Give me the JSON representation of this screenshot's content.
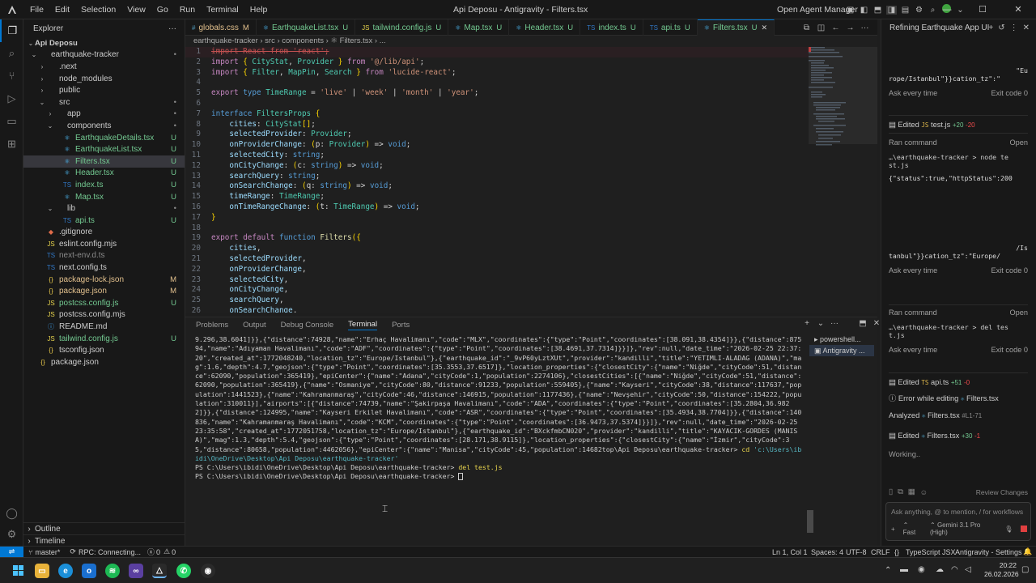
{
  "menu": [
    "File",
    "Edit",
    "Selection",
    "View",
    "Go",
    "Run",
    "Terminal",
    "Help"
  ],
  "window_title": "Api Deposu - Antigravity - Filters.tsx",
  "open_agent_manager": "Open Agent Manager",
  "sidebar": {
    "title": "Explorer",
    "root": "Api Deposu",
    "items": [
      {
        "label": "earthquake-tracker",
        "indent": 0,
        "arrow": "⌄",
        "status": "•"
      },
      {
        "label": ".next",
        "indent": 1,
        "arrow": "›",
        "status": ""
      },
      {
        "label": "node_modules",
        "indent": 1,
        "arrow": "›",
        "status": ""
      },
      {
        "label": "public",
        "indent": 1,
        "arrow": "›",
        "status": ""
      },
      {
        "label": "src",
        "indent": 1,
        "arrow": "⌄",
        "status": "•"
      },
      {
        "label": "app",
        "indent": 2,
        "arrow": "›",
        "status": "•"
      },
      {
        "label": "components",
        "indent": 2,
        "arrow": "⌄",
        "status": "•"
      },
      {
        "label": "EarthquakeDetails.tsx",
        "indent": 3,
        "arrow": "",
        "status": "U"
      },
      {
        "label": "EarthquakeList.tsx",
        "indent": 3,
        "arrow": "",
        "status": "U"
      },
      {
        "label": "Filters.tsx",
        "indent": 3,
        "arrow": "",
        "status": "U"
      },
      {
        "label": "Header.tsx",
        "indent": 3,
        "arrow": "",
        "status": "U"
      },
      {
        "label": "index.ts",
        "indent": 3,
        "arrow": "",
        "status": "U"
      },
      {
        "label": "Map.tsx",
        "indent": 3,
        "arrow": "",
        "status": "U"
      },
      {
        "label": "lib",
        "indent": 2,
        "arrow": "⌄",
        "status": "•"
      },
      {
        "label": "api.ts",
        "indent": 3,
        "arrow": "",
        "status": "U"
      },
      {
        "label": ".gitignore",
        "indent": 1,
        "arrow": "",
        "status": ""
      },
      {
        "label": "eslint.config.mjs",
        "indent": 1,
        "arrow": "",
        "status": ""
      },
      {
        "label": "next-env.d.ts",
        "indent": 1,
        "arrow": "",
        "status": ""
      },
      {
        "label": "next.config.ts",
        "indent": 1,
        "arrow": "",
        "status": ""
      },
      {
        "label": "package-lock.json",
        "indent": 1,
        "arrow": "",
        "status": "M"
      },
      {
        "label": "package.json",
        "indent": 1,
        "arrow": "",
        "status": "M"
      },
      {
        "label": "postcss.config.js",
        "indent": 1,
        "arrow": "",
        "status": "U"
      },
      {
        "label": "postcss.config.mjs",
        "indent": 1,
        "arrow": "",
        "status": ""
      },
      {
        "label": "README.md",
        "indent": 1,
        "arrow": "",
        "status": ""
      },
      {
        "label": "tailwind.config.js",
        "indent": 1,
        "arrow": "",
        "status": "U"
      },
      {
        "label": "tsconfig.json",
        "indent": 1,
        "arrow": "",
        "status": ""
      },
      {
        "label": "package.json",
        "indent": 0,
        "arrow": "",
        "status": ""
      }
    ],
    "outline": "Outline",
    "timeline": "Timeline"
  },
  "tabs": [
    {
      "label": "globals.css",
      "status": "M"
    },
    {
      "label": "EarthquakeList.tsx",
      "status": "U"
    },
    {
      "label": "tailwind.config.js",
      "status": "U"
    },
    {
      "label": "Map.tsx",
      "status": "U"
    },
    {
      "label": "Header.tsx",
      "status": "U"
    },
    {
      "label": "index.ts",
      "status": "U"
    },
    {
      "label": "api.ts",
      "status": "U"
    },
    {
      "label": "Filters.tsx",
      "status": "U"
    }
  ],
  "breadcrumb": "earthquake-tracker  ›  src  ›  components  ›  ⚛ Filters.tsx  ›  ...",
  "code_lines": [
    "import React from 'react';",
    "import { CityStat, Provider } from '@/lib/api';",
    "import { Filter, MapPin, Search } from 'lucide-react';",
    "",
    "export type TimeRange = 'live' | 'week' | 'month' | 'year';",
    "",
    "interface FiltersProps {",
    "    cities: CityStat[];",
    "    selectedProvider: Provider;",
    "    onProviderChange: (p: Provider) => void;",
    "    selectedCity: string;",
    "    onCityChange: (c: string) => void;",
    "    searchQuery: string;",
    "    onSearchChange: (q: string) => void;",
    "    timeRange: TimeRange;",
    "    onTimeRangeChange: (t: TimeRange) => void;",
    "}",
    "",
    "export default function Filters({",
    "    cities,",
    "    selectedProvider,",
    "    onProviderChange,",
    "    selectedCity,",
    "    onCityChange,",
    "    searchQuery,",
    "    onSearchChange,"
  ],
  "panel_tabs": [
    "Problems",
    "Output",
    "Debug Console",
    "Terminal",
    "Ports"
  ],
  "terminal": {
    "output": "9.296,38.6041]}},{\"distance\":74928,\"name\":\"Erhaç Havalimanı\",\"code\":\"MLX\",\"coordinates\":{\"type\":\"Point\",\"coordinates\":[38.091,38.4354]}},{\"distance\":87594,\"name\":\"Adıyaman Havalimanı\",\"code\":\"ADF\",\"coordinates\":{\"type\":\"Point\",\"coordinates\":[38.4691,37.7314]}}]},\"rev\":null,\"date_time\":\"2026-02-25 22:37:20\",\"created_at\":1772048240,\"location_tz\":\"Europe/Istanbul\"},{\"earthquake_id\":\"_9vP60yLztXUt\",\"provider\":\"kandilli\",\"title\":\"YETIMLI-ALADAG (ADANA)\",\"mag\":1.6,\"depth\":4.7,\"geojson\":{\"type\":\"Point\",\"coordinates\":[35.3553,37.6517]},\"location_properties\":{\"closestCity\":{\"name\":\"Niğde\",\"cityCode\":51,\"distance\":62090,\"population\":365419},\"epiCenter\":{\"name\":\"Adana\",\"cityCode\":1,\"population\":2274106},\"closestCities\":[{\"name\":\"Niğde\",\"cityCode\":51,\"distance\":62090,\"population\":365419},{\"name\":\"Osmaniye\",\"cityCode\":80,\"distance\":91233,\"population\":559405},{\"name\":\"Kayseri\",\"cityCode\":38,\"distance\":117637,\"population\":1441523},{\"name\":\"Kahramanmaraş\",\"cityCode\":46,\"distance\":146915,\"population\":1177436},{\"name\":\"Nevşehir\",\"cityCode\":50,\"distance\":154222,\"population\":310011}],\"airports\":[{\"distance\":74739,\"name\":\"Şakirpaşa Havalimanı\",\"code\":\"ADA\",\"coordinates\":{\"type\":\"Point\",\"coordinates\":[35.2804,36.9822]}},{\"distance\":124995,\"name\":\"Kayseri Erkilet Havalimanı\",\"code\":\"ASR\",\"coordinates\":{\"type\":\"Point\",\"coordinates\":[35.4934,38.7704]}},{\"distance\":140836,\"name\":\"Kahramanmaraş Havalimanı\",\"code\":\"KCM\",\"coordinates\":{\"type\":\"Point\",\"coordinates\":[36.9473,37.5374]}}]},\"rev\":null,\"date_time\":\"2026-02-25 23:35:58\",\"created_at\":1772051758,\"location_tz\":\"Europe/Istanbul\"},{\"earthquake_id\":\"BXckfmbCN020\",\"provider\":\"kandilli\",\"title\":\"KAYACIK-GORDES (MANISA)\",\"mag\":1.3,\"depth\":5.4,\"geojson\":{\"type\":\"Point\",\"coordinates\":[28.171,38.9115]},\"location_properties\":{\"closestCity\":{\"name\":\"İzmir\",\"cityCode\":35,\"distance\":80658,\"population\":4462056},\"epiCenter\":{\"name\":\"Manisa\",\"cityCode\":45,\"population\":14682",
    "last_prefix": "top\\Api Deposu\\earthquake-tracker> ",
    "cmd1": "cd",
    "cmd1_arg": " 'c:\\Users\\ibidi\\OneDrive\\Desktop\\Api Deposu\\earthquake-tracker'",
    "ps2": "PS C:\\Users\\ibidi\\OneDrive\\Desktop\\Api Deposu\\earthquake-tracker> ",
    "cmd2": "del test.js",
    "ps3": "PS C:\\Users\\ibidi\\OneDrive\\Desktop\\Api Deposu\\earthquake-tracker> "
  },
  "terminal_list": [
    "powershell...",
    "Antigravity ..."
  ],
  "agent": {
    "title": "Refining Earthquake App UI",
    "snippet1_line1": "\"Eu",
    "snippet1_line2": "rope/Istanbul\"}}cation_tz\":\"",
    "ask_every_time": "Ask every time",
    "exit_code": "Exit code 0",
    "edited": "Edited",
    "test_js": "test.js",
    "test_add": "+20",
    "test_rem": "-20",
    "ran_command": "Ran command",
    "open": "Open",
    "cmd1": "…\\earthquake-tracker > node te st.js",
    "cmd1_out": "{\"status\":true,\"httpStatus\":200",
    "snippet2_line1": "/Is",
    "snippet2_line2": "tanbul\"}}cation_tz\":\"Europe/",
    "cmd2": "…\\earthquake-tracker > del tes t.js",
    "api_ts": "api.ts",
    "api_add": "+51",
    "api_rem": "-0",
    "error_editing": "Error while editing",
    "filters": "Filters.tsx",
    "analyzed": "Analyzed",
    "analyzed_range": "#L1-71",
    "filters_add": "+30",
    "filters_rem": "-1",
    "working": "Working..",
    "review_changes": "Review Changes",
    "input_placeholder": "Ask anything, @ to mention, / for workflows",
    "mode": "Fast",
    "model": "Gemini 3.1 Pro (High)"
  },
  "status": {
    "branch": "master*",
    "rpc": "RPC: Connecting...",
    "errors": "0",
    "warnings": "0",
    "position": "Ln 1, Col 1",
    "spaces": "Spaces: 4",
    "encoding": "UTF-8",
    "eol": "CRLF",
    "language": "TypeScript JSX",
    "settings": "Antigravity - Settings"
  },
  "clock": {
    "time": "20:22",
    "date": "26.02.2026"
  },
  "colors": {
    "accent": "#0078d4",
    "untracked": "#73c991",
    "modified": "#e2c08d"
  }
}
